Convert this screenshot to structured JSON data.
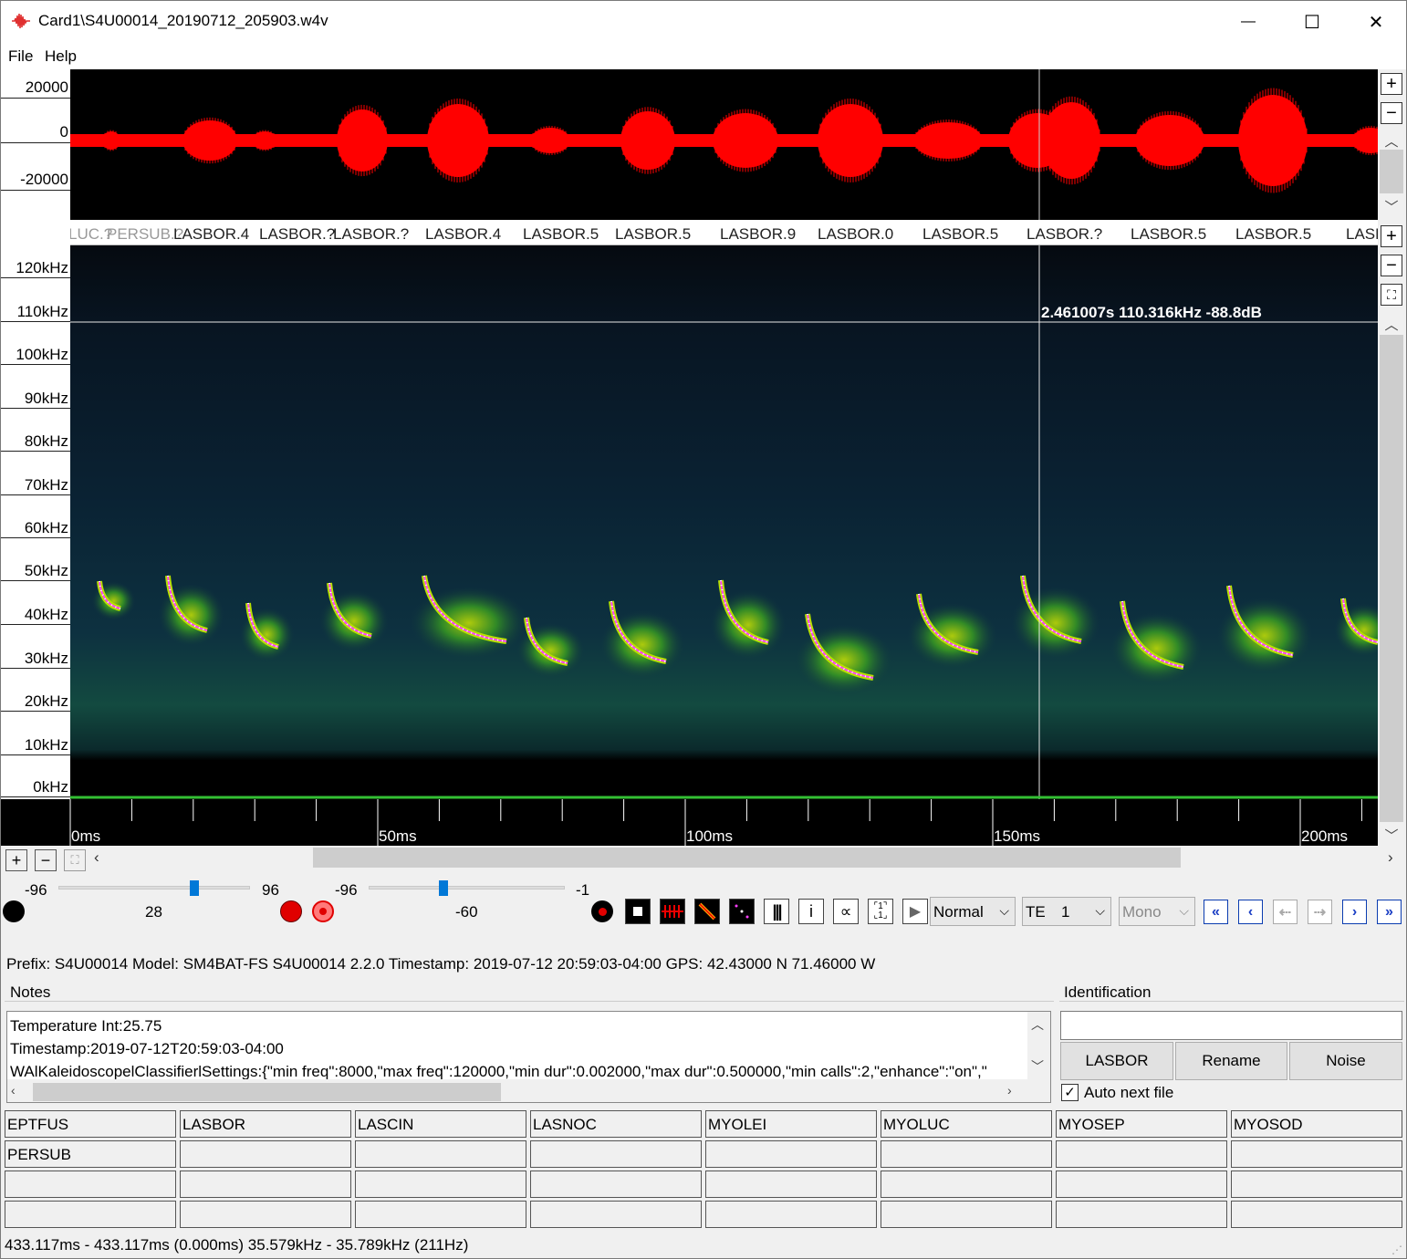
{
  "window": {
    "title": "Card1\\S4U00014_20190712_205903.w4v",
    "minimize": "—",
    "maximize": "☐",
    "close": "✕"
  },
  "menu": {
    "file": "File",
    "help": "Help"
  },
  "waveform": {
    "y_ticks": [
      "20000",
      "0",
      "-20000"
    ]
  },
  "call_labels": [
    "LUC.?",
    "PERSUB.?",
    "LASBOR.4",
    "LASBOR.?",
    "LASBOR.?",
    "LASBOR.4",
    "LASBOR.5",
    "LASBOR.5",
    "LASBOR.9",
    "LASBOR.0",
    "LASBOR.5",
    "LASBOR.?",
    "LASBOR.5",
    "LASBOR.5",
    "LASB"
  ],
  "spectrogram": {
    "freq_ticks": [
      "120kHz",
      "110kHz",
      "100kHz",
      "90kHz",
      "80kHz",
      "70kHz",
      "60kHz",
      "50kHz",
      "40kHz",
      "30kHz",
      "20kHz",
      "10kHz",
      "0kHz"
    ],
    "cursor_readout": "2.461007s 110.316kHz -88.8dB",
    "time_ticks": [
      "0ms",
      "50ms",
      "100ms",
      "150ms",
      "200ms"
    ],
    "colors": {
      "call_core": "#b8e000",
      "call_trace": "#ff40ff",
      "waveform": "#ff0000",
      "baseline": "#33c033"
    }
  },
  "controls": {
    "slider1": {
      "min": "-96",
      "max": "96",
      "value": "28",
      "fraction": 0.71
    },
    "slider2": {
      "min": "-96",
      "max": "-1",
      "value": "-60",
      "fraction": 0.38
    },
    "mode_select": "Normal",
    "te_label": "TE",
    "te_value": "1",
    "channel_select": "Mono"
  },
  "meta": {
    "line": "Prefix: S4U00014  Model: SM4BAT-FS S4U00014 2.2.0  Timestamp: 2019-07-12 20:59:03-04:00  GPS:  42.43000 N 71.46000 W"
  },
  "notes": {
    "label": "Notes",
    "lines": [
      "Temperature Int:25.75",
      "Timestamp:2019-07-12T20:59:03-04:00",
      "WAlKaleidoscopelClassifierlSettings:{\"min freq\":8000,\"max freq\":120000,\"min dur\":0.002000,\"max dur\":0.500000,\"min calls\":2,\"enhance\":\"on\",\""
    ]
  },
  "identification": {
    "label": "Identification",
    "input_value": "",
    "buttons": [
      "LASBOR",
      "Rename",
      "Noise"
    ],
    "auto_next": "Auto next file"
  },
  "species_grid": [
    [
      "EPTFUS",
      "LASBOR",
      "LASCIN",
      "LASNOC",
      "MYOLEI",
      "MYOLUC",
      "MYOSEP",
      "MYOSOD"
    ],
    [
      "PERSUB",
      "",
      "",
      "",
      "",
      "",
      "",
      ""
    ],
    [
      "",
      "",
      "",
      "",
      "",
      "",
      "",
      ""
    ],
    [
      "",
      "",
      "",
      "",
      "",
      "",
      "",
      ""
    ]
  ],
  "status": "433.117ms - 433.117ms (0.000ms) 35.579kHz - 35.789kHz (211Hz)"
}
